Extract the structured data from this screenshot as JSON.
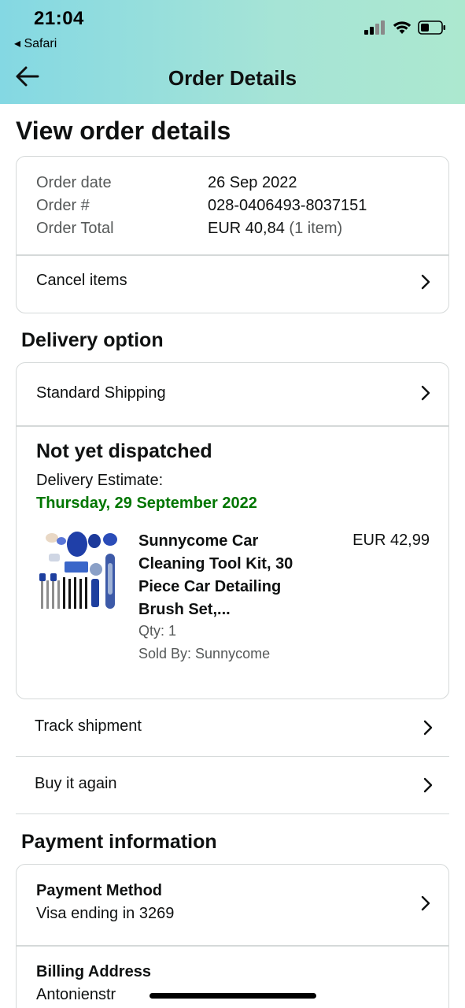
{
  "status_bar": {
    "time": "21:04",
    "back_app": "◂ Safari"
  },
  "nav": {
    "title": "Order Details"
  },
  "page": {
    "heading": "View order details"
  },
  "order_summary": {
    "date_label": "Order date",
    "date_value": "26 Sep 2022",
    "number_label": "Order #",
    "number_value": "028-0406493-8037151",
    "total_label": "Order Total",
    "total_value": "EUR 40,84",
    "total_items": "(1 item)",
    "cancel_label": "Cancel items"
  },
  "delivery": {
    "section_title": "Delivery option",
    "shipping_option": "Standard Shipping",
    "status": "Not yet dispatched",
    "estimate_label": "Delivery Estimate:",
    "estimate_date": "Thursday, 29 September 2022",
    "estimate_color": "#007600",
    "product": {
      "title": "Sunnycome Car Cleaning Tool Kit, 30 Piece Car Detailing Brush Set,...",
      "price": "EUR 42,99",
      "qty": "Qty: 1",
      "sold_by": "Sold By: Sunnycome"
    }
  },
  "actions": {
    "track": "Track shipment",
    "buy_again": "Buy it again"
  },
  "payment": {
    "section_title": "Payment information",
    "method_label": "Payment Method",
    "method_value": "Visa ending in 3269",
    "billing_label": "Billing Address",
    "billing_value": "Antonienstr"
  },
  "colors": {
    "header_gradient_start": "#84d8e3",
    "header_gradient_end": "#ace8cf",
    "border": "#d5d9d9",
    "muted_text": "#565959"
  }
}
